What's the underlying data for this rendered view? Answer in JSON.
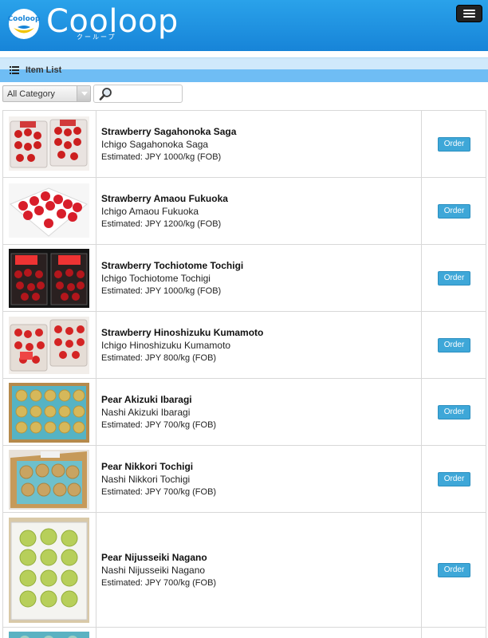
{
  "header": {
    "logo_badge_text": "Cooloop",
    "logo_text": "Cooloop",
    "logo_sub": "クーループ",
    "menu_icon": "hamburger-menu-icon"
  },
  "list_header": {
    "icon": "list-icon",
    "title": "Item List"
  },
  "filters": {
    "category_selected": "All Category",
    "search_icon": "magnifier-icon",
    "search_placeholder": ""
  },
  "order_label": "Order",
  "items": [
    {
      "name": "Strawberry Sagahonoka Saga",
      "sub": "Ichigo Sagahonoka Saga",
      "price": "Estimated: JPY 1000/kg (FOB)"
    },
    {
      "name": "Strawberry Amaou Fukuoka",
      "sub": "Ichigo Amaou Fukuoka",
      "price": "Estimated: JPY 1200/kg (FOB)"
    },
    {
      "name": "Strawberry Tochiotome Tochigi",
      "sub": "Ichigo Tochiotome Tochigi",
      "price": "Estimated: JPY 1000/kg (FOB)"
    },
    {
      "name": "Strawberry Hinoshizuku Kumamoto",
      "sub": "Ichigo Hinoshizuku Kumamoto",
      "price": "Estimated: JPY 800/kg (FOB)"
    },
    {
      "name": "Pear Akizuki Ibaragi",
      "sub": "Nashi Akizuki Ibaragi",
      "price": "Estimated: JPY 700/kg (FOB)"
    },
    {
      "name": "Pear Nikkori Tochigi",
      "sub": "Nashi Nikkori Tochigi",
      "price": "Estimated: JPY 700/kg (FOB)"
    },
    {
      "name": "Pear Nijusseiki Nagano",
      "sub": "Nashi Nijusseiki Nagano",
      "price": "Estimated: JPY 700/kg (FOB)"
    }
  ]
}
